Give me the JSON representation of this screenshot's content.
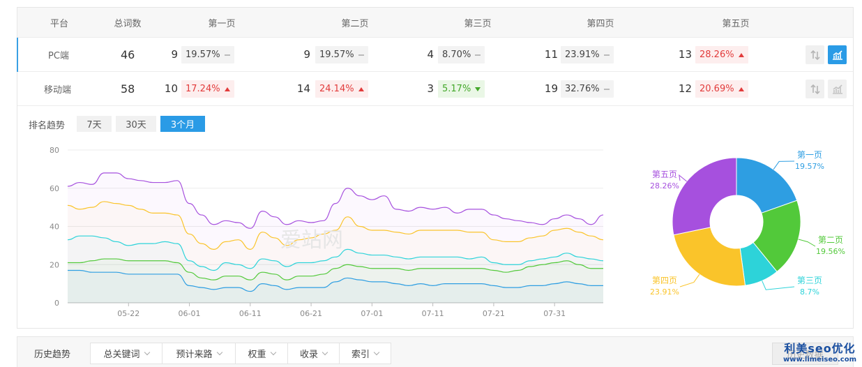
{
  "table": {
    "headers": [
      "平台",
      "总词数",
      "第一页",
      "第二页",
      "第三页",
      "第四页",
      "第五页"
    ],
    "rows": [
      {
        "platform": "PC端",
        "total": "46",
        "pages": [
          {
            "count": "9",
            "pct": "19.57%",
            "trend": "flat"
          },
          {
            "count": "9",
            "pct": "19.57%",
            "trend": "flat"
          },
          {
            "count": "4",
            "pct": "8.70%",
            "trend": "flat"
          },
          {
            "count": "11",
            "pct": "23.91%",
            "trend": "flat"
          },
          {
            "count": "13",
            "pct": "28.26%",
            "trend": "up"
          }
        ]
      },
      {
        "platform": "移动端",
        "total": "58",
        "pages": [
          {
            "count": "10",
            "pct": "17.24%",
            "trend": "up"
          },
          {
            "count": "14",
            "pct": "24.14%",
            "trend": "up"
          },
          {
            "count": "3",
            "pct": "5.17%",
            "trend": "down"
          },
          {
            "count": "19",
            "pct": "32.76%",
            "trend": "flat"
          },
          {
            "count": "12",
            "pct": "20.69%",
            "trend": "up"
          }
        ]
      }
    ]
  },
  "trend": {
    "label": "排名趋势",
    "ranges": [
      "7天",
      "30天",
      "3个月"
    ],
    "active_range": "3个月",
    "watermark": "爱站网"
  },
  "bottom": {
    "title": "历史趋势",
    "tabs": [
      "总关键词",
      "预计来路",
      "权重",
      "收录",
      "索引"
    ],
    "history_button": "历史数据"
  },
  "brand": {
    "name": "利美seo优化",
    "url": "www.limeiseo.com"
  },
  "colors": {
    "p1": "#2e9ee2",
    "p2": "#52c93a",
    "p3": "#2dd3d9",
    "p4": "#fac42a",
    "p5": "#a650de",
    "accent": "#2a9be6",
    "up": "#e23b3b",
    "down": "#43a82a"
  },
  "chart_data": [
    {
      "type": "line",
      "title": "",
      "xlabel": "",
      "ylabel": "",
      "ylim": [
        0,
        80
      ],
      "yticks": [
        0,
        20,
        40,
        60,
        80
      ],
      "xticks": [
        "05-22",
        "06-01",
        "06-11",
        "06-21",
        "07-01",
        "07-11",
        "07-21",
        "07-31"
      ],
      "x": [
        "05-12",
        "05-14",
        "05-16",
        "05-18",
        "05-20",
        "05-22",
        "05-24",
        "05-26",
        "05-28",
        "05-30",
        "06-01",
        "06-03",
        "06-05",
        "06-07",
        "06-09",
        "06-11",
        "06-13",
        "06-15",
        "06-17",
        "06-19",
        "06-21",
        "06-23",
        "06-25",
        "06-27",
        "06-29",
        "07-01",
        "07-03",
        "07-05",
        "07-07",
        "07-09",
        "07-11",
        "07-13",
        "07-15",
        "07-17",
        "07-19",
        "07-21",
        "07-23",
        "07-25",
        "07-27",
        "07-29",
        "07-31",
        "08-02",
        "08-04",
        "08-06",
        "08-08"
      ],
      "series": [
        {
          "name": "第五页",
          "color": "#a650de",
          "values": [
            61,
            63,
            62,
            68,
            68,
            65,
            64,
            63,
            63,
            64,
            52,
            46,
            41,
            43,
            42,
            39,
            48,
            45,
            41,
            43,
            42,
            43,
            52,
            60,
            56,
            54,
            56,
            49,
            48,
            50,
            49,
            50,
            47,
            49,
            49,
            46,
            44,
            43,
            42,
            41,
            44,
            46,
            44,
            41,
            46
          ]
        },
        {
          "name": "第四页",
          "color": "#fac42a",
          "values": [
            51,
            49,
            50,
            53,
            52,
            51,
            49,
            47,
            47,
            46,
            36,
            31,
            28,
            32,
            33,
            28,
            37,
            34,
            30,
            33,
            34,
            36,
            38,
            45,
            40,
            38,
            38,
            37,
            36,
            38,
            38,
            38,
            38,
            37,
            37,
            33,
            32,
            32,
            34,
            35,
            38,
            39,
            37,
            35,
            33
          ]
        },
        {
          "name": "第三页",
          "color": "#2dd3d9",
          "values": [
            33,
            35,
            35,
            34,
            32,
            30,
            31,
            31,
            32,
            31,
            22,
            19,
            17,
            21,
            20,
            18,
            23,
            22,
            19,
            21,
            21,
            22,
            24,
            28,
            26,
            25,
            25,
            24,
            23,
            24,
            24,
            24,
            24,
            23,
            24,
            21,
            20,
            20,
            22,
            23,
            24,
            26,
            24,
            23,
            22
          ]
        },
        {
          "name": "第二页",
          "color": "#52c93a",
          "values": [
            21,
            21,
            22,
            23,
            23,
            22,
            22,
            22,
            22,
            21,
            16,
            13,
            12,
            14,
            14,
            12,
            16,
            15,
            12,
            14,
            14,
            15,
            18,
            20,
            19,
            18,
            18,
            18,
            17,
            18,
            18,
            18,
            18,
            18,
            18,
            17,
            16,
            17,
            19,
            20,
            21,
            22,
            20,
            18,
            18
          ]
        },
        {
          "name": "第一页",
          "color": "#2e9ee2",
          "values": [
            17,
            17,
            16,
            16,
            16,
            15,
            15,
            15,
            15,
            15,
            9,
            8,
            7,
            8,
            8,
            6,
            10,
            9,
            7,
            8,
            8,
            8,
            11,
            13,
            12,
            11,
            11,
            10,
            9,
            10,
            9,
            10,
            10,
            10,
            10,
            9,
            8,
            8,
            9,
            9,
            10,
            11,
            10,
            9,
            9
          ]
        }
      ]
    },
    {
      "type": "pie",
      "title": "",
      "categories": [
        "第一页",
        "第二页",
        "第三页",
        "第四页",
        "第五页"
      ],
      "values": [
        19.57,
        19.56,
        8.7,
        23.91,
        28.26
      ],
      "labels": [
        "19.57%",
        "19.56%",
        "8.7%",
        "23.91%",
        "28.26%"
      ],
      "colors": [
        "#2e9ee2",
        "#52c93a",
        "#2dd3d9",
        "#fac42a",
        "#a650de"
      ]
    }
  ]
}
